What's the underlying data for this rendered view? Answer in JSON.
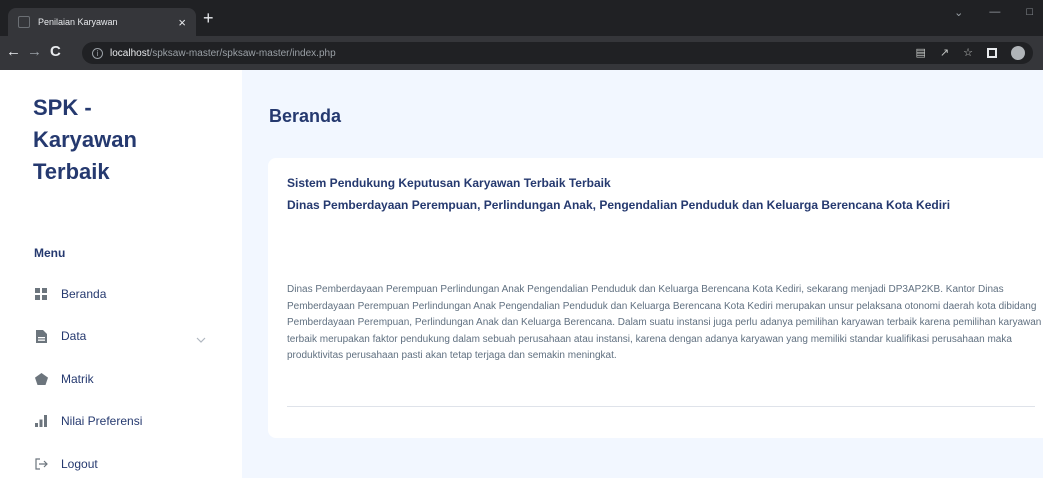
{
  "browser": {
    "tab_title": "Penilaian Karyawan",
    "tab_close": "×",
    "new_tab": "+",
    "url_host": "localhost",
    "url_path": "/spksaw-master/spksaw-master/index.php"
  },
  "sidebar": {
    "brand": "SPK - Karyawan Terbaik",
    "menu_title": "Menu",
    "items": [
      {
        "label": "Beranda",
        "icon": "grid-icon"
      },
      {
        "label": "Data",
        "icon": "file-icon"
      },
      {
        "label": "Matrik",
        "icon": "pentagon-icon"
      },
      {
        "label": "Nilai Preferensi",
        "icon": "bar-chart-icon"
      },
      {
        "label": "Logout",
        "icon": "logout-icon"
      }
    ]
  },
  "main": {
    "page_title": "Beranda",
    "card": {
      "heading": "Sistem Pendukung Keputusan Karyawan Terbaik Terbaik",
      "subheading": "Dinas Pemberdayaan Perempuan, Perlindungan Anak, Pengendalian Penduduk dan Keluarga Berencana Kota Kediri",
      "body": "Dinas Pemberdayaan Perempuan Perlindungan Anak Pengendalian Penduduk dan Keluarga Berencana Kota Kediri, sekarang menjadi DP3AP2KB. Kantor Dinas Pemberdayaan Perempuan Perlindungan Anak Pengendalian Penduduk dan Keluarga Berencana Kota Kediri merupakan unsur pelaksana otonomi daerah kota dibidang Pemberdayaan Perempuan, Perlindungan Anak dan Keluarga Berencana. Dalam suatu instansi juga perlu adanya pemilihan karyawan terbaik karena pemilihan karyawan terbaik merupakan faktor pendukung dalam sebuah perusahaan atau instansi, karena dengan adanya karyawan yang memiliki standar kualifikasi perusahaan maka produktivitas perusahaan pasti akan tetap terjaga dan semakin meningkat."
    }
  },
  "colors": {
    "primary_text": "#25396f",
    "content_bg": "#f2f7ff",
    "body_text": "#607080"
  }
}
